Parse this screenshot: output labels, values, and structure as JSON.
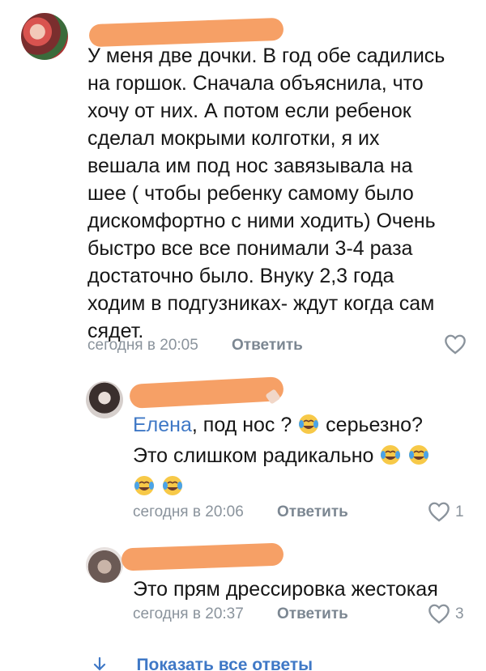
{
  "comments": [
    {
      "text_lines": [
        "У меня две дочки. В год обе садились",
        "на горшок. Сначала объяснила, что",
        "хочу от них. А потом если ребенок",
        "сделал мокрыми колготки, я их",
        "вешала им под нос завязывала на",
        "шее ( чтобы ребенку самому было",
        "дискомфортно с ними ходить) Очень",
        "быстро все все  понимали 3-4 раза",
        "достаточно было.  Внуку 2,3 года",
        "ходим в подгузниках- ждут когда сам",
        "сядет."
      ],
      "time": "сегодня в 20:05",
      "reply_label": "Ответить",
      "likes": ""
    },
    {
      "mention": "Елена",
      "line1_after_mention": ", под нос ?",
      "line1_end": " серьезно?",
      "line2": "Это слишком радикально ",
      "time": "сегодня в 20:06",
      "reply_label": "Ответить",
      "likes": "1"
    },
    {
      "text": "Это прям дрессировка жестокая",
      "time": "сегодня в 20:37",
      "reply_label": "Ответить",
      "likes": "3"
    }
  ],
  "show_all_label": "Показать все ответы",
  "colors": {
    "accent": "#3f78c6",
    "redaction": "#f6a066",
    "meta": "#8a939c"
  },
  "icons": [
    "heart-icon",
    "tears-of-joy-emoji",
    "arrow-down-icon"
  ]
}
